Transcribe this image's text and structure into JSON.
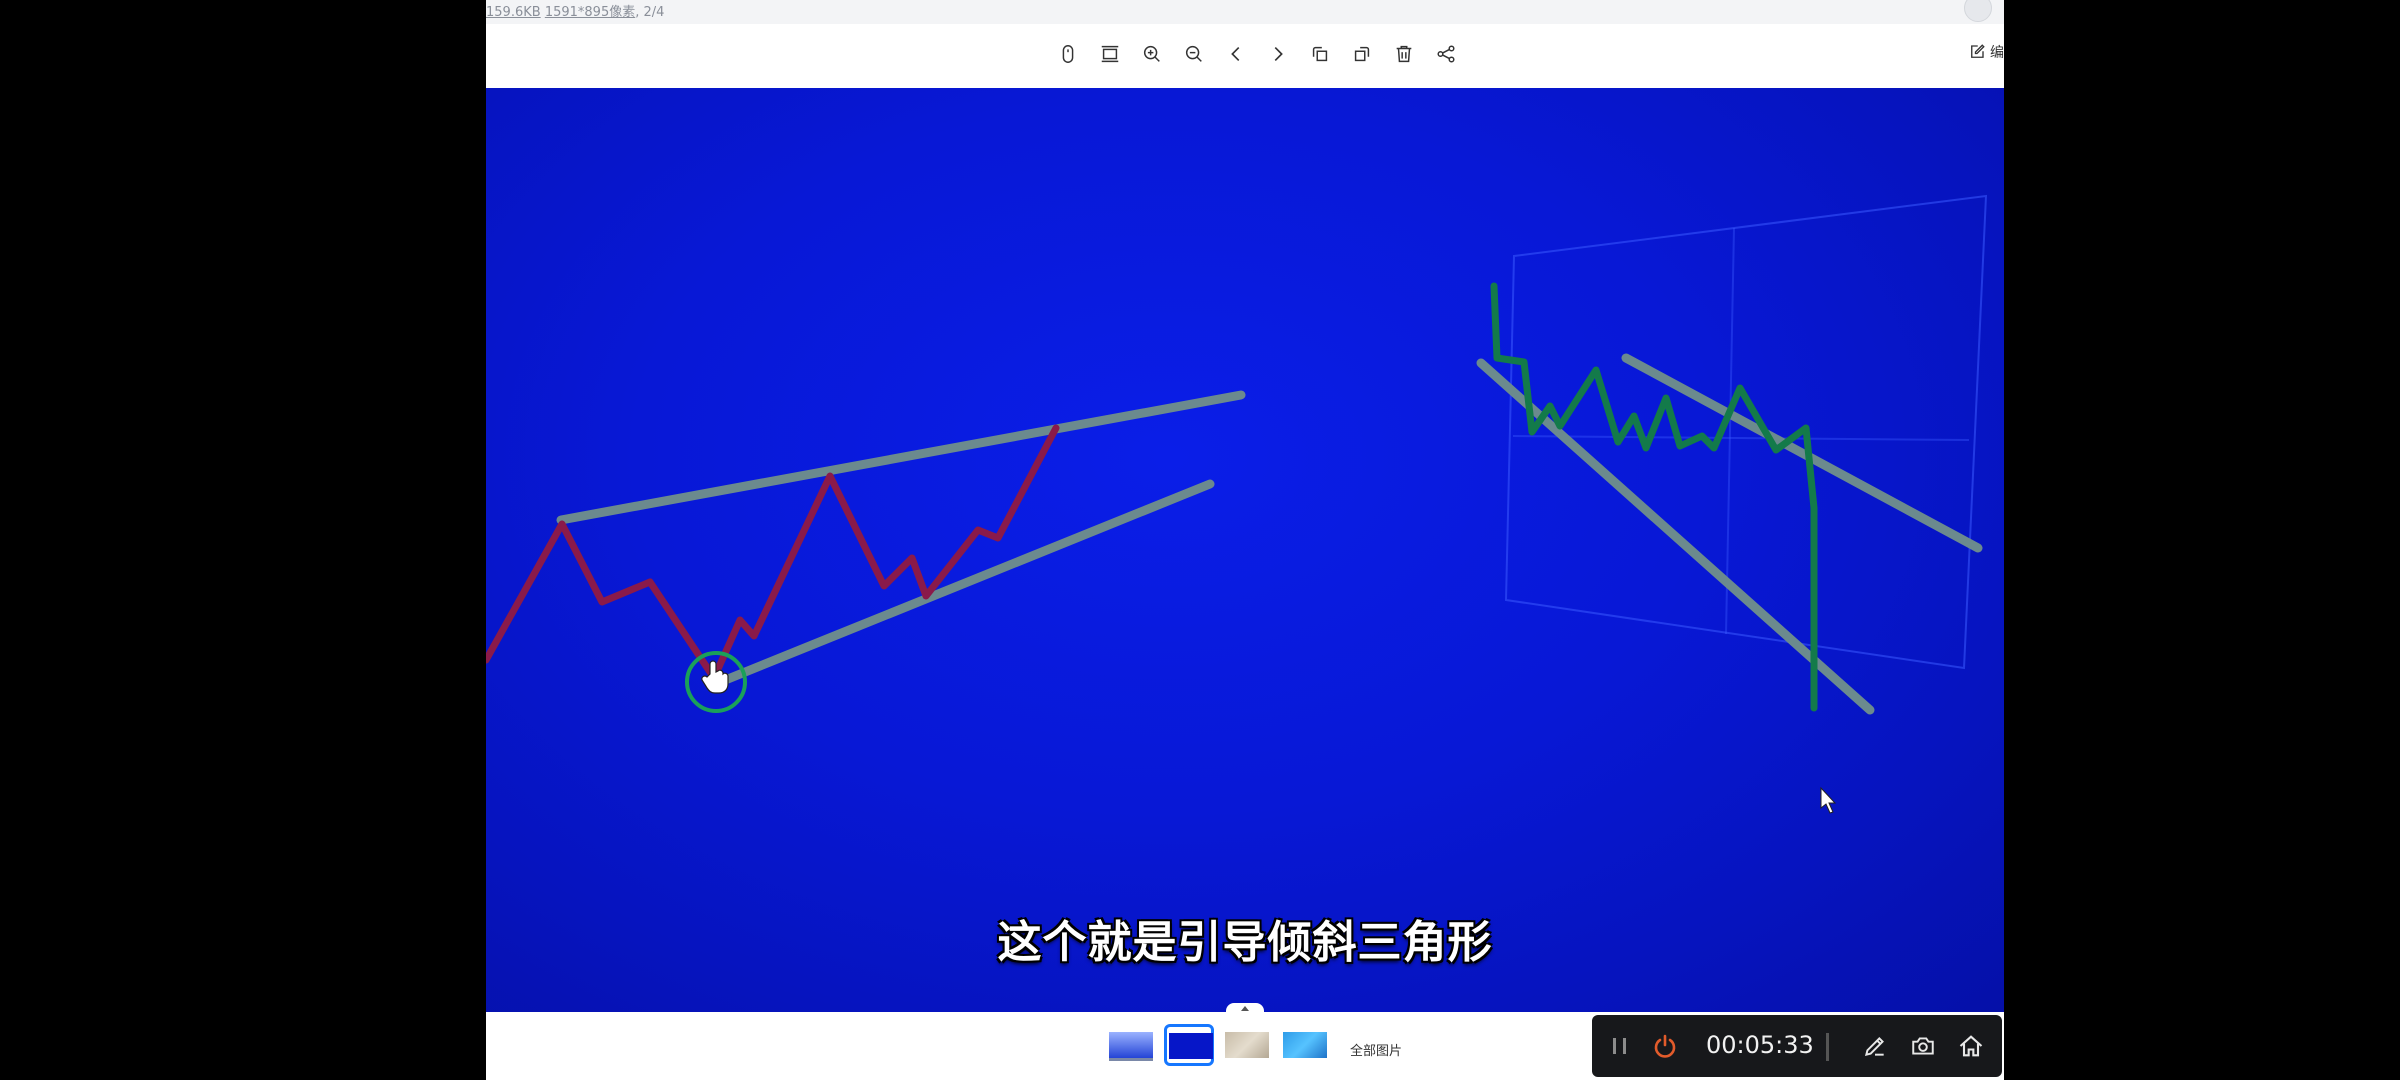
{
  "topbar": {
    "file_size": "159.6KB",
    "dimensions": "1591*895像素",
    "page_counter": ", 2/4"
  },
  "toolbar": {
    "icons": [
      "mouse-icon",
      "fit-screen-icon",
      "zoom-in-icon",
      "zoom-out-icon",
      "previous-icon",
      "next-icon",
      "rotate-left-icon",
      "rotate-right-icon",
      "delete-icon",
      "share-icon"
    ],
    "edit_label": "编"
  },
  "slide": {
    "caption": "这个就是引导倾斜三角形"
  },
  "bottombar": {
    "thumbnails": [
      "laptop-blue-thumbnail",
      "blue-triangle-thumbnail",
      "beige-texture-thumbnail",
      "windows-desktop-thumbnail"
    ],
    "active_thumbnail": 2,
    "all_images_label": "全部图片"
  },
  "recorder": {
    "time": "00:05:33",
    "controls": [
      "pause-icon",
      "stop-icon",
      "pen-icon",
      "camera-icon",
      "home-icon"
    ]
  },
  "colors": {
    "slide_bg": "#0818d6",
    "trendline": "#6b8a8e",
    "price_rising": "#8a1a4a",
    "price_falling": "#137a4a",
    "recorder_stop": "#e25b2b",
    "thumbnail_active": "#1677ff"
  }
}
